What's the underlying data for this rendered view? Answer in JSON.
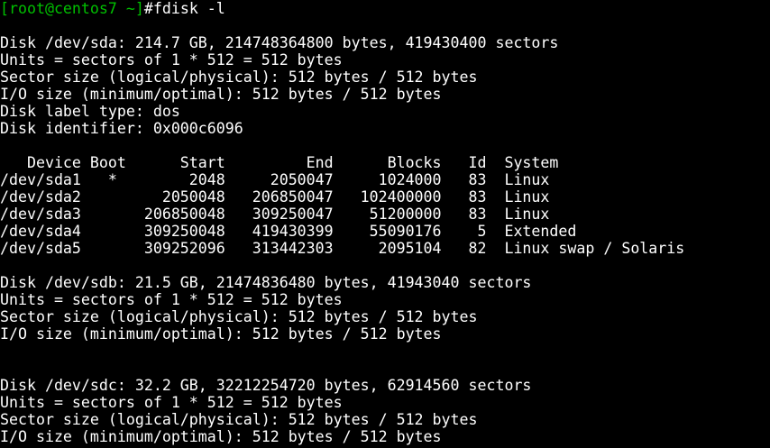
{
  "prompt": {
    "user_host": "[root@centos7 ~]",
    "symbol": "#",
    "command": "fdisk -l"
  },
  "output": {
    "sda": {
      "disk": "Disk /dev/sda: 214.7 GB, 214748364800 bytes, 419430400 sectors",
      "units": "Units = sectors of 1 * 512 = 512 bytes",
      "sector_size": "Sector size (logical/physical): 512 bytes / 512 bytes",
      "io_size": "I/O size (minimum/optimal): 512 bytes / 512 bytes",
      "label_type": "Disk label type: dos",
      "identifier": "Disk identifier: 0x000c6096"
    },
    "partition_table": {
      "header": "   Device Boot      Start         End      Blocks   Id  System",
      "rows": [
        "/dev/sda1   *        2048     2050047     1024000   83  Linux",
        "/dev/sda2         2050048   206850047   102400000   83  Linux",
        "/dev/sda3       206850048   309250047    51200000   83  Linux",
        "/dev/sda4       309250048   419430399    55090176    5  Extended",
        "/dev/sda5       309252096   313442303     2095104   82  Linux swap / Solaris"
      ]
    },
    "sdb": {
      "disk": "Disk /dev/sdb: 21.5 GB, 21474836480 bytes, 41943040 sectors",
      "units": "Units = sectors of 1 * 512 = 512 bytes",
      "sector_size": "Sector size (logical/physical): 512 bytes / 512 bytes",
      "io_size": "I/O size (minimum/optimal): 512 bytes / 512 bytes"
    },
    "sdc": {
      "disk": "Disk /dev/sdc: 32.2 GB, 32212254720 bytes, 62914560 sectors",
      "units": "Units = sectors of 1 * 512 = 512 bytes",
      "sector_size": "Sector size (logical/physical): 512 bytes / 512 bytes",
      "io_size": "I/O size (minimum/optimal): 512 bytes / 512 bytes"
    }
  },
  "colors": {
    "background": "#000000",
    "text": "#ffffff",
    "prompt": "#00c000"
  }
}
